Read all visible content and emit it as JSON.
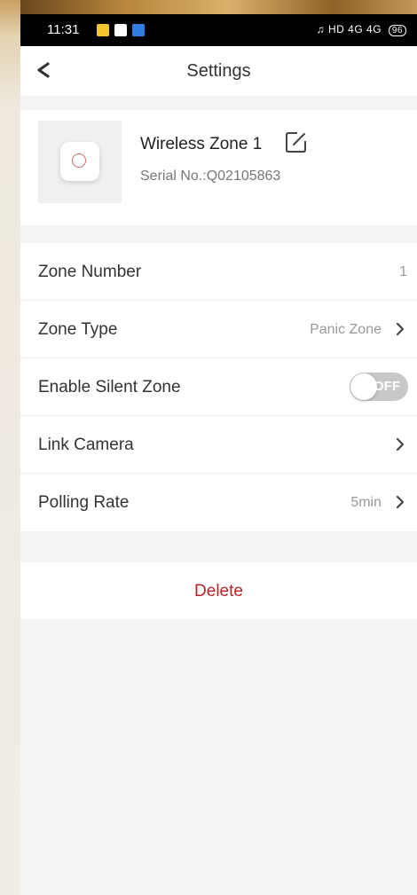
{
  "status_bar": {
    "time": "11:31",
    "right_indicators": "HD 4G 4G",
    "battery": "96"
  },
  "header": {
    "title": "Settings",
    "back_icon": "chevron-left-icon"
  },
  "device": {
    "name": "Wireless Zone 1",
    "serial": "Serial No.:Q02105863",
    "edit_icon": "edit-icon"
  },
  "settings": {
    "zone_number": {
      "label": "Zone Number",
      "value": "1"
    },
    "zone_type": {
      "label": "Zone Type",
      "value": "Panic Zone"
    },
    "silent_zone": {
      "label": "Enable Silent Zone",
      "toggle_text": "OFF",
      "enabled": false
    },
    "link_camera": {
      "label": "Link Camera"
    },
    "polling_rate": {
      "label": "Polling Rate",
      "value": "5min"
    }
  },
  "actions": {
    "delete_label": "Delete"
  },
  "colors": {
    "accent_delete": "#b5252a",
    "toggle_off": "#c8c8c8"
  }
}
